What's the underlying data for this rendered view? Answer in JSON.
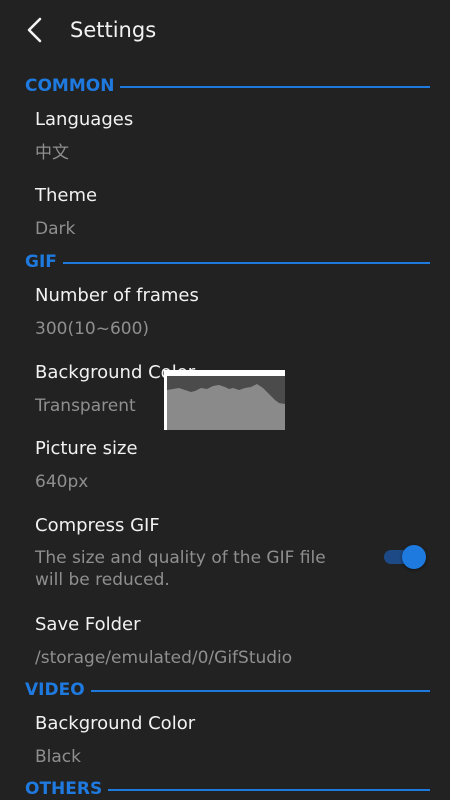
{
  "header": {
    "title": "Settings",
    "back_icon": "back-arrow-icon"
  },
  "colors": {
    "accent": "#1f7ae0",
    "background": "#222222",
    "text_primary": "#f2f2f2",
    "text_secondary": "#8f8f8f"
  },
  "sections": {
    "common": {
      "label": "COMMON",
      "languages": {
        "title": "Languages",
        "value": "中文"
      },
      "theme": {
        "title": "Theme",
        "value": "Dark"
      }
    },
    "gif": {
      "label": "GIF",
      "frames": {
        "title": "Number of frames",
        "value": "300(10~600)"
      },
      "background": {
        "title": "Background Color",
        "value": "Transparent"
      },
      "picture_size": {
        "title": "Picture size",
        "value": "640px"
      },
      "compress": {
        "title": "Compress GIF",
        "description": "The size and quality of the GIF file will be reduced.",
        "enabled": true
      },
      "save_folder": {
        "title": "Save Folder",
        "value": "/storage/emulated/0/GifStudio"
      }
    },
    "video": {
      "label": "VIDEO",
      "background": {
        "title": "Background Color",
        "value": "Black"
      }
    },
    "others": {
      "label": "OTHERS"
    }
  }
}
